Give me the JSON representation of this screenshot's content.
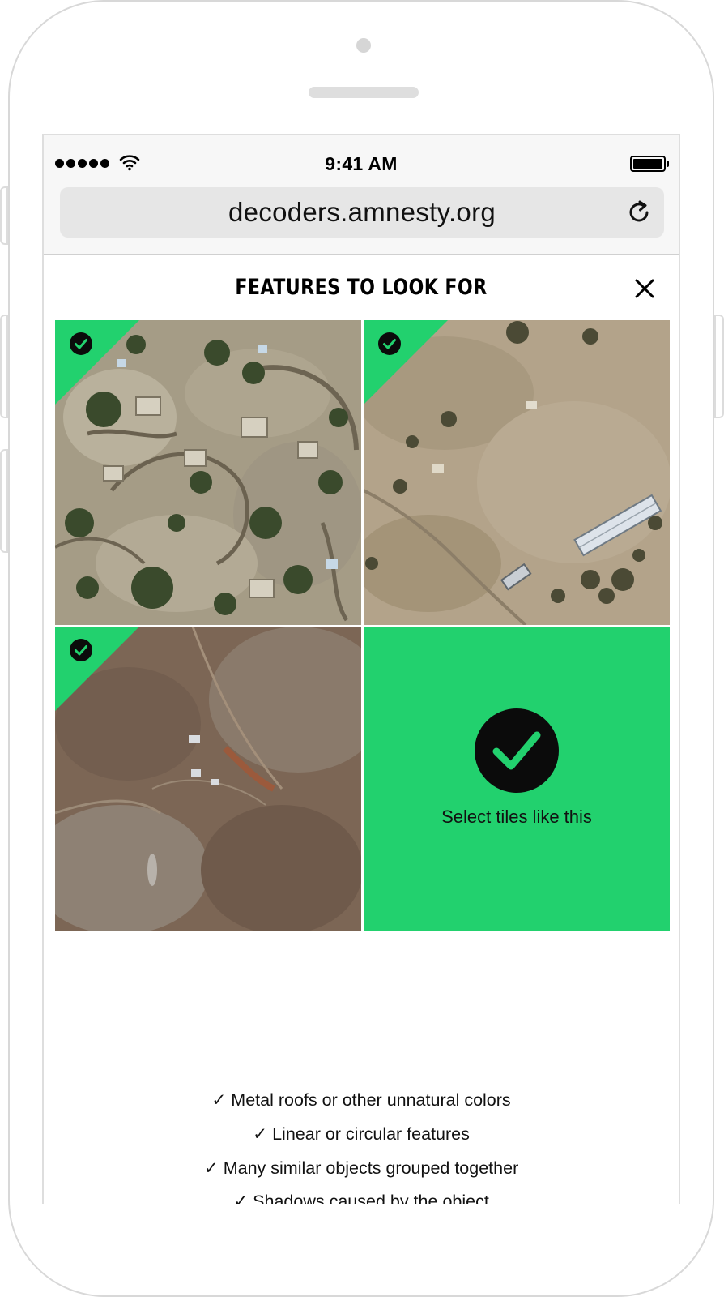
{
  "status_bar": {
    "time": "9:41 AM",
    "signal_icon": "signal-dots-icon",
    "wifi_icon": "wifi-icon",
    "battery_icon": "battery-icon",
    "battery_level": 1.0
  },
  "browser": {
    "url": "decoders.amnesty.org",
    "reload_icon": "reload-icon"
  },
  "modal": {
    "title": "FEATURES TO LOOK FOR",
    "close_icon": "close-icon"
  },
  "tiles": [
    {
      "kind": "satellite",
      "checked": true,
      "scene": "village-compounds"
    },
    {
      "kind": "satellite",
      "checked": true,
      "scene": "metal-roof-building"
    },
    {
      "kind": "satellite",
      "checked": true,
      "scene": "arid-terrain-structures"
    },
    {
      "kind": "example",
      "label": "Select tiles like this",
      "icon": "check-circle-icon"
    }
  ],
  "features": [
    "✓ Metal roofs or other unnatural colors",
    "✓ Linear or circular features",
    "✓ Many similar objects grouped together",
    "✓ Shadows caused by the object"
  ],
  "colors": {
    "accent_green": "#22d16e",
    "text": "#111111",
    "chrome_bg": "#f7f7f7",
    "url_bg": "#e6e6e6"
  }
}
